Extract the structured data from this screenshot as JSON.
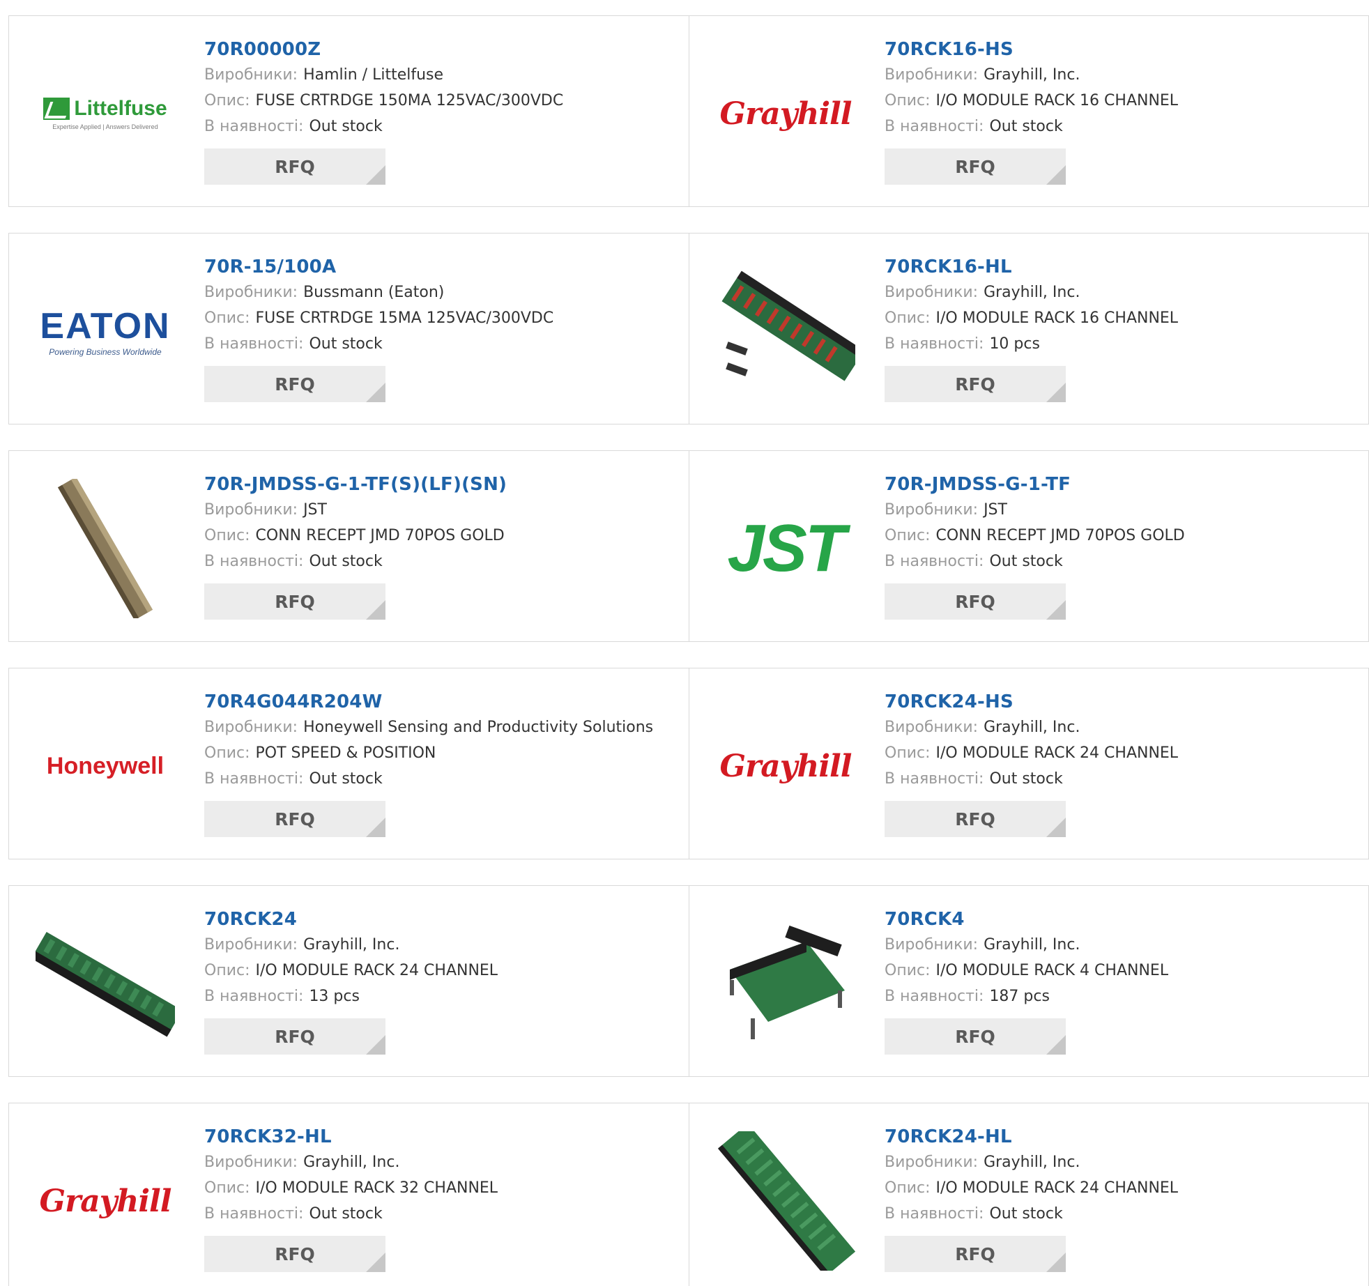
{
  "labels": {
    "manufacturer": "Виробники:",
    "description": "Опис:",
    "stock": "В наявності:",
    "rfq": "RFQ"
  },
  "products": [
    {
      "pn": "70R00000Z",
      "manufacturer": "Hamlin / Littelfuse",
      "description": "FUSE CRTRDGE 150MA 125VAC/300VDC",
      "stock": "Out stock",
      "image": "littelfuse-logo",
      "logo_text": "Littelfuse",
      "logo_sub": "Expertise Applied | Answers Delivered"
    },
    {
      "pn": "70RCK16-HS",
      "manufacturer": "Grayhill, Inc.",
      "description": "I/O MODULE RACK 16 CHANNEL",
      "stock": "Out stock",
      "image": "grayhill-logo",
      "logo_text": "Grayhill"
    },
    {
      "pn": "70R-15/100A",
      "manufacturer": "Bussmann (Eaton)",
      "description": "FUSE CRTRDGE 15MA 125VAC/300VDC",
      "stock": "Out stock",
      "image": "eaton-logo",
      "logo_text": "EATON",
      "logo_sub": "Powering Business Worldwide"
    },
    {
      "pn": "70RCK16-HL",
      "manufacturer": "Grayhill, Inc.",
      "description": "I/O MODULE RACK 16 CHANNEL",
      "stock": "10 pcs",
      "image": "rack-board-photo"
    },
    {
      "pn": "70R-JMDSS-G-1-TF(S)(LF)(SN)",
      "manufacturer": "JST",
      "description": "CONN RECEPT JMD 70POS GOLD",
      "stock": "Out stock",
      "image": "connector-photo"
    },
    {
      "pn": "70R-JMDSS-G-1-TF",
      "manufacturer": "JST",
      "description": "CONN RECEPT JMD 70POS GOLD",
      "stock": "Out stock",
      "image": "jst-logo",
      "logo_text": "JST"
    },
    {
      "pn": "70R4G044R204W",
      "manufacturer": "Honeywell Sensing and Productivity Solutions",
      "description": "POT SPEED & POSITION",
      "stock": "Out stock",
      "image": "honeywell-logo",
      "logo_text": "Honeywell"
    },
    {
      "pn": "70RCK24-HS",
      "manufacturer": "Grayhill, Inc.",
      "description": "I/O MODULE RACK 24 CHANNEL",
      "stock": "Out stock",
      "image": "grayhill-logo",
      "logo_text": "Grayhill"
    },
    {
      "pn": "70RCK24",
      "manufacturer": "Grayhill, Inc.",
      "description": "I/O MODULE RACK 24 CHANNEL",
      "stock": "13 pcs",
      "image": "rack-board-photo"
    },
    {
      "pn": "70RCK4",
      "manufacturer": "Grayhill, Inc.",
      "description": "I/O MODULE RACK 4 CHANNEL",
      "stock": "187 pcs",
      "image": "rack4-board-photo"
    },
    {
      "pn": "70RCK32-HL",
      "manufacturer": "Grayhill, Inc.",
      "description": "I/O MODULE RACK 32 CHANNEL",
      "stock": "Out stock",
      "image": "grayhill-logo",
      "logo_text": "Grayhill"
    },
    {
      "pn": "70RCK24-HL",
      "manufacturer": "Grayhill, Inc.",
      "description": "I/O MODULE RACK 24 CHANNEL",
      "stock": "Out stock",
      "image": "rack-board-photo"
    }
  ],
  "colors": {
    "link": "#1f63a8",
    "label": "#9a9a9a",
    "button_bg": "#ececec",
    "grayhill_red": "#d31a22",
    "littelfuse_green": "#2f9a3a",
    "eaton_blue": "#1d4f9c",
    "jst_green": "#27a548",
    "honeywell_red": "#d61f26"
  }
}
